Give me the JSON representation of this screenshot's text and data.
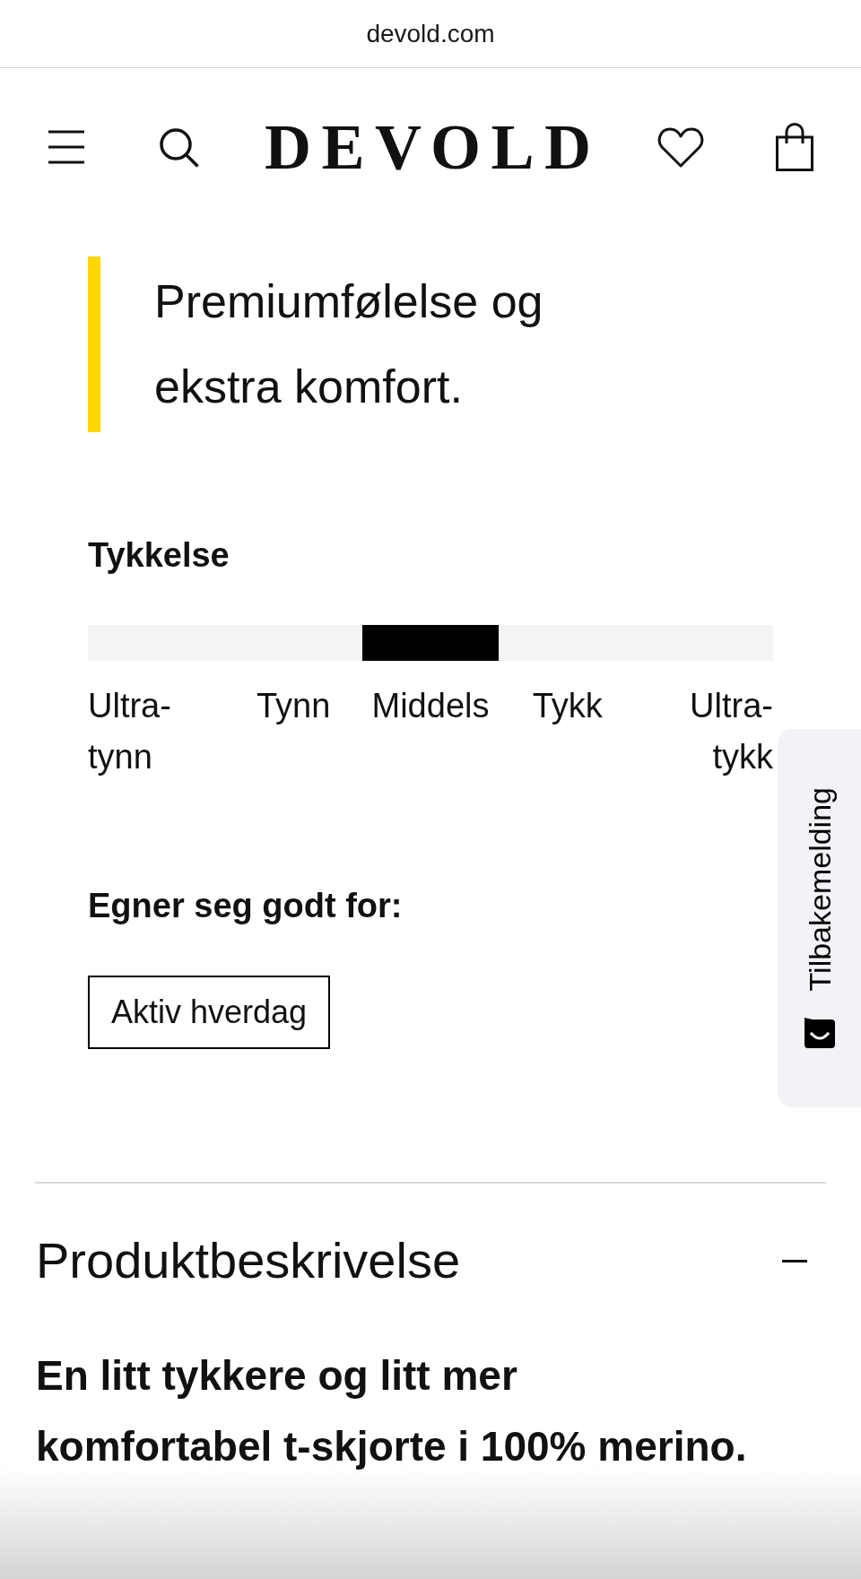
{
  "browser": {
    "url": "devold.com"
  },
  "header": {
    "logo": "DEVOLD"
  },
  "highlight": {
    "text": "Premiumfølelse og ekstra komfort."
  },
  "thickness": {
    "title": "Tykkelse",
    "levels": [
      {
        "label": "Ultra-tynn",
        "selected": false
      },
      {
        "label": "Tynn",
        "selected": false
      },
      {
        "label": "Middels",
        "selected": true
      },
      {
        "label": "Tykk",
        "selected": false
      },
      {
        "label": "Ultra-tykk",
        "selected": false
      }
    ]
  },
  "suitable_for": {
    "title": "Egner seg godt for:",
    "tags": [
      "Aktiv hverdag"
    ]
  },
  "feedback_tab": {
    "label": "Tilbakemelding"
  },
  "accordion": {
    "title": "Produktbeskrivelse",
    "expanded": true,
    "body": "En litt tykkere og litt mer komfortabel t-skjorte i 100% merino."
  }
}
